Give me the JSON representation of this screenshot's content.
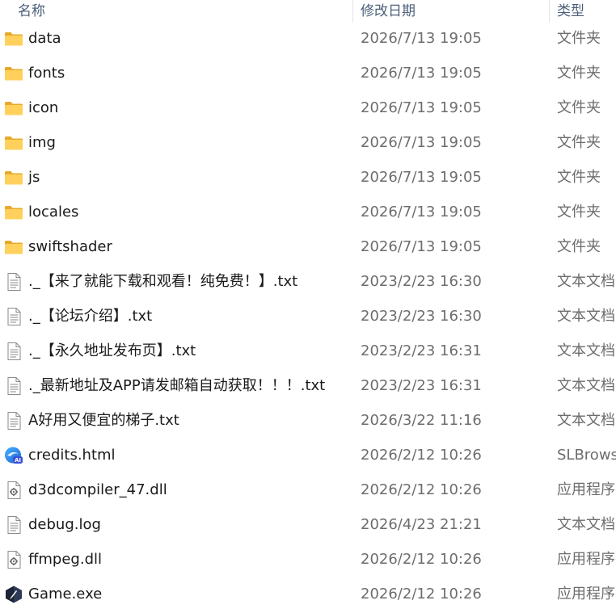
{
  "columns": {
    "name": "名称",
    "date": "修改日期",
    "type": "类型"
  },
  "files": [
    {
      "name": "data",
      "date": "2026/7/13 19:05",
      "type": "文件夹",
      "icon": "folder-icon"
    },
    {
      "name": "fonts",
      "date": "2026/7/13 19:05",
      "type": "文件夹",
      "icon": "folder-icon"
    },
    {
      "name": "icon",
      "date": "2026/7/13 19:05",
      "type": "文件夹",
      "icon": "folder-icon"
    },
    {
      "name": "img",
      "date": "2026/7/13 19:05",
      "type": "文件夹",
      "icon": "folder-icon"
    },
    {
      "name": "js",
      "date": "2026/7/13 19:05",
      "type": "文件夹",
      "icon": "folder-icon"
    },
    {
      "name": "locales",
      "date": "2026/7/13 19:05",
      "type": "文件夹",
      "icon": "folder-icon"
    },
    {
      "name": "swiftshader",
      "date": "2026/7/13 19:05",
      "type": "文件夹",
      "icon": "folder-icon"
    },
    {
      "name": "._【来了就能下载和观看！纯免费！】.txt",
      "date": "2023/2/23 16:30",
      "type": "文本文档",
      "icon": "text-file-icon"
    },
    {
      "name": "._【论坛介绍】.txt",
      "date": "2023/2/23 16:30",
      "type": "文本文档",
      "icon": "text-file-icon"
    },
    {
      "name": "._【永久地址发布页】.txt",
      "date": "2023/2/23 16:31",
      "type": "文本文档",
      "icon": "text-file-icon"
    },
    {
      "name": "._最新地址及APP请发邮箱自动获取！！！.txt",
      "date": "2023/2/23 16:31",
      "type": "文本文档",
      "icon": "text-file-icon"
    },
    {
      "name": "A好用又便宜的梯子.txt",
      "date": "2026/3/22 11:16",
      "type": "文本文档",
      "icon": "text-file-icon"
    },
    {
      "name": "credits.html",
      "date": "2026/2/12 10:26",
      "type": "SLBrowser",
      "icon": "browser-html-icon"
    },
    {
      "name": "d3dcompiler_47.dll",
      "date": "2026/2/12 10:26",
      "type": "应用程序扩展",
      "icon": "dll-file-icon"
    },
    {
      "name": "debug.log",
      "date": "2026/4/23 21:21",
      "type": "文本文档",
      "icon": "text-file-icon"
    },
    {
      "name": "ffmpeg.dll",
      "date": "2026/2/12 10:26",
      "type": "应用程序扩展",
      "icon": "dll-file-icon"
    },
    {
      "name": "Game.exe",
      "date": "2026/2/12 10:26",
      "type": "应用程序",
      "icon": "game-exe-icon"
    }
  ]
}
